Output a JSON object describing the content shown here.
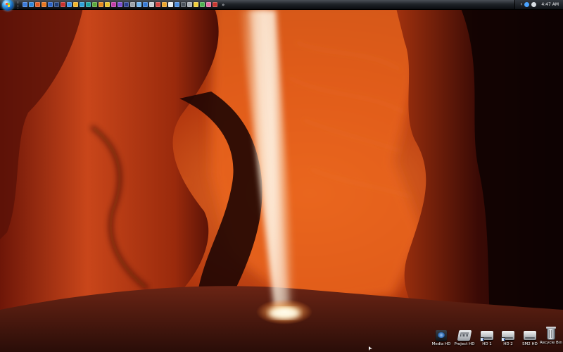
{
  "taskbar": {
    "start_button": "start-orb",
    "overflow_chevron": "»",
    "quick_launch": [
      {
        "icon": "show-desktop-icon",
        "color": "#3b7ad9"
      },
      {
        "icon": "ie-icon",
        "color": "#2f86d8"
      },
      {
        "icon": "media-player-icon",
        "color": "#e05a20"
      },
      {
        "icon": "firefox-icon",
        "color": "#e9771f"
      },
      {
        "icon": "outlook-icon",
        "color": "#2a62c4"
      },
      {
        "icon": "photoshop-icon",
        "color": "#1e3f7a"
      },
      {
        "icon": "app-red-icon",
        "color": "#c9302c"
      },
      {
        "icon": "app-blue-icon",
        "color": "#3a8ee6"
      },
      {
        "icon": "smiley-icon",
        "color": "#f2b428"
      },
      {
        "icon": "globe-icon",
        "color": "#2fa0d8"
      },
      {
        "icon": "app-teal-icon",
        "color": "#1aa3a1"
      },
      {
        "icon": "app-green-icon",
        "color": "#5aa83a"
      },
      {
        "icon": "app-orange-icon",
        "color": "#e58a1f"
      },
      {
        "icon": "app-yellow-icon",
        "color": "#e8c02a"
      },
      {
        "icon": "app-magenta-icon",
        "color": "#c23aa7"
      },
      {
        "icon": "app-purple-icon",
        "color": "#7b4fd1"
      },
      {
        "icon": "app-navy-icon",
        "color": "#2b3f8f"
      },
      {
        "icon": "app-gray-icon",
        "color": "#9aa1a9"
      },
      {
        "icon": "app-lightblue-icon",
        "color": "#6fb4ef"
      },
      {
        "icon": "app-blue2-icon",
        "color": "#3478d4"
      },
      {
        "icon": "app-silver-icon",
        "color": "#c7ccd2"
      },
      {
        "icon": "app-red2-icon",
        "color": "#d64541"
      },
      {
        "icon": "app-amber-icon",
        "color": "#eaa32a"
      },
      {
        "icon": "app-white-icon",
        "color": "#e8ebee"
      },
      {
        "icon": "app-blue3-icon",
        "color": "#4d8fe0"
      },
      {
        "icon": "app-dark-icon",
        "color": "#4b535c"
      },
      {
        "icon": "app-gray2-icon",
        "color": "#a6adb4"
      },
      {
        "icon": "app-yellow2-icon",
        "color": "#f0cf3a"
      },
      {
        "icon": "app-green2-icon",
        "color": "#4caf50"
      },
      {
        "icon": "app-pink-icon",
        "color": "#e66aa3"
      },
      {
        "icon": "app-red3-icon",
        "color": "#c7362f"
      }
    ]
  },
  "tray": {
    "arrow": "‹",
    "icons": [
      {
        "icon": "network-icon",
        "color": "#4aa3ff"
      },
      {
        "icon": "volume-icon",
        "color": "#d8dde3"
      }
    ],
    "clock": "4:47 AM"
  },
  "desktop_icons": [
    {
      "label": "Media HD",
      "kind": "media"
    },
    {
      "label": "Project HD",
      "kind": "project"
    },
    {
      "label": "HD 1",
      "kind": "drive"
    },
    {
      "label": "HD 2",
      "kind": "drive"
    },
    {
      "label": "SM2 HD",
      "kind": "drive"
    },
    {
      "label": "Recycle Bin",
      "kind": "bin"
    }
  ],
  "colors": {
    "rock_light": "#e8651e",
    "rock_mid": "#a9310f",
    "rock_dark": "#3a0b05",
    "light_beam": "#fff4dc"
  }
}
